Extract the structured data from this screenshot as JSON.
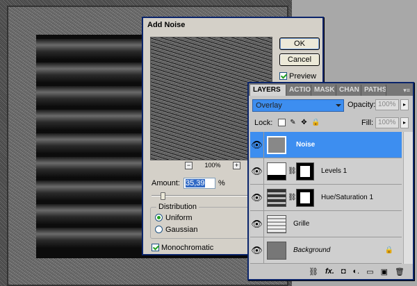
{
  "dialog": {
    "title": "Add Noise",
    "ok_label": "OK",
    "cancel_label": "Cancel",
    "preview_label": "Preview",
    "zoom": "100%",
    "zoom_out": "−",
    "zoom_in": "+",
    "amount_label": "Amount:",
    "amount_value": "35,39",
    "amount_unit": "%",
    "distribution_label": "Distribution",
    "uniform_label": "Uniform",
    "gaussian_label": "Gaussian",
    "monochromatic_label": "Monochromatic"
  },
  "layers_panel": {
    "tabs": [
      "LAYERS",
      "ACTIO",
      "MASK",
      "CHAN",
      "PATHS"
    ],
    "menu_glyph": "▾≡",
    "blend_mode": "Overlay",
    "opacity_label": "Opacity:",
    "opacity_value": "100%",
    "lock_label": "Lock:",
    "fill_label": "Fill:",
    "fill_value": "100%",
    "arrow_glyph": "▸",
    "layers": [
      {
        "name": "Noise"
      },
      {
        "name": "Levels 1"
      },
      {
        "name": "Hue/Saturation 1"
      },
      {
        "name": "Grille"
      },
      {
        "name": "Background"
      }
    ],
    "footer_icons": [
      "link-icon",
      "fx-icon",
      "mask-icon",
      "adjustment-icon",
      "folder-icon",
      "new-layer-icon",
      "trash-icon"
    ],
    "footer_glyphs": [
      "⛓",
      "fx.",
      "◘",
      "◐.",
      "▭",
      "▣",
      "🗑"
    ]
  },
  "colors": {
    "selection": "#3d8ef0",
    "dialog_bg": "#d4d0c8",
    "window_border": "#0a246a"
  }
}
